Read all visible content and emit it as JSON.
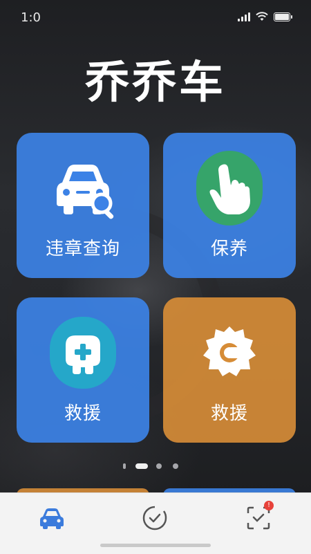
{
  "status_bar": {
    "time": "1:0"
  },
  "app": {
    "title": "乔乔车"
  },
  "tiles": [
    {
      "label": "违章查询",
      "icon": "car-search-icon",
      "color": "#3c82e6"
    },
    {
      "label": "保养",
      "icon": "hand-pointer-icon",
      "color": "#3c82e6"
    },
    {
      "label": "救援",
      "icon": "car-medical-icon",
      "color": "#3c82e6"
    },
    {
      "label": "救援",
      "icon": "rescue-gear-icon",
      "color": "#d68c37"
    }
  ],
  "pager": {
    "current_page": 2,
    "total_pages": 4
  },
  "tab_bar": {
    "tabs": [
      {
        "icon": "car-icon",
        "active": true
      },
      {
        "icon": "check-circle-icon",
        "active": false
      },
      {
        "icon": "scan-icon",
        "active": false,
        "badge": "!"
      }
    ]
  },
  "colors": {
    "active_tab": "#3b7bdc",
    "inactive_tab": "#555555",
    "badge": "#e7423a"
  }
}
